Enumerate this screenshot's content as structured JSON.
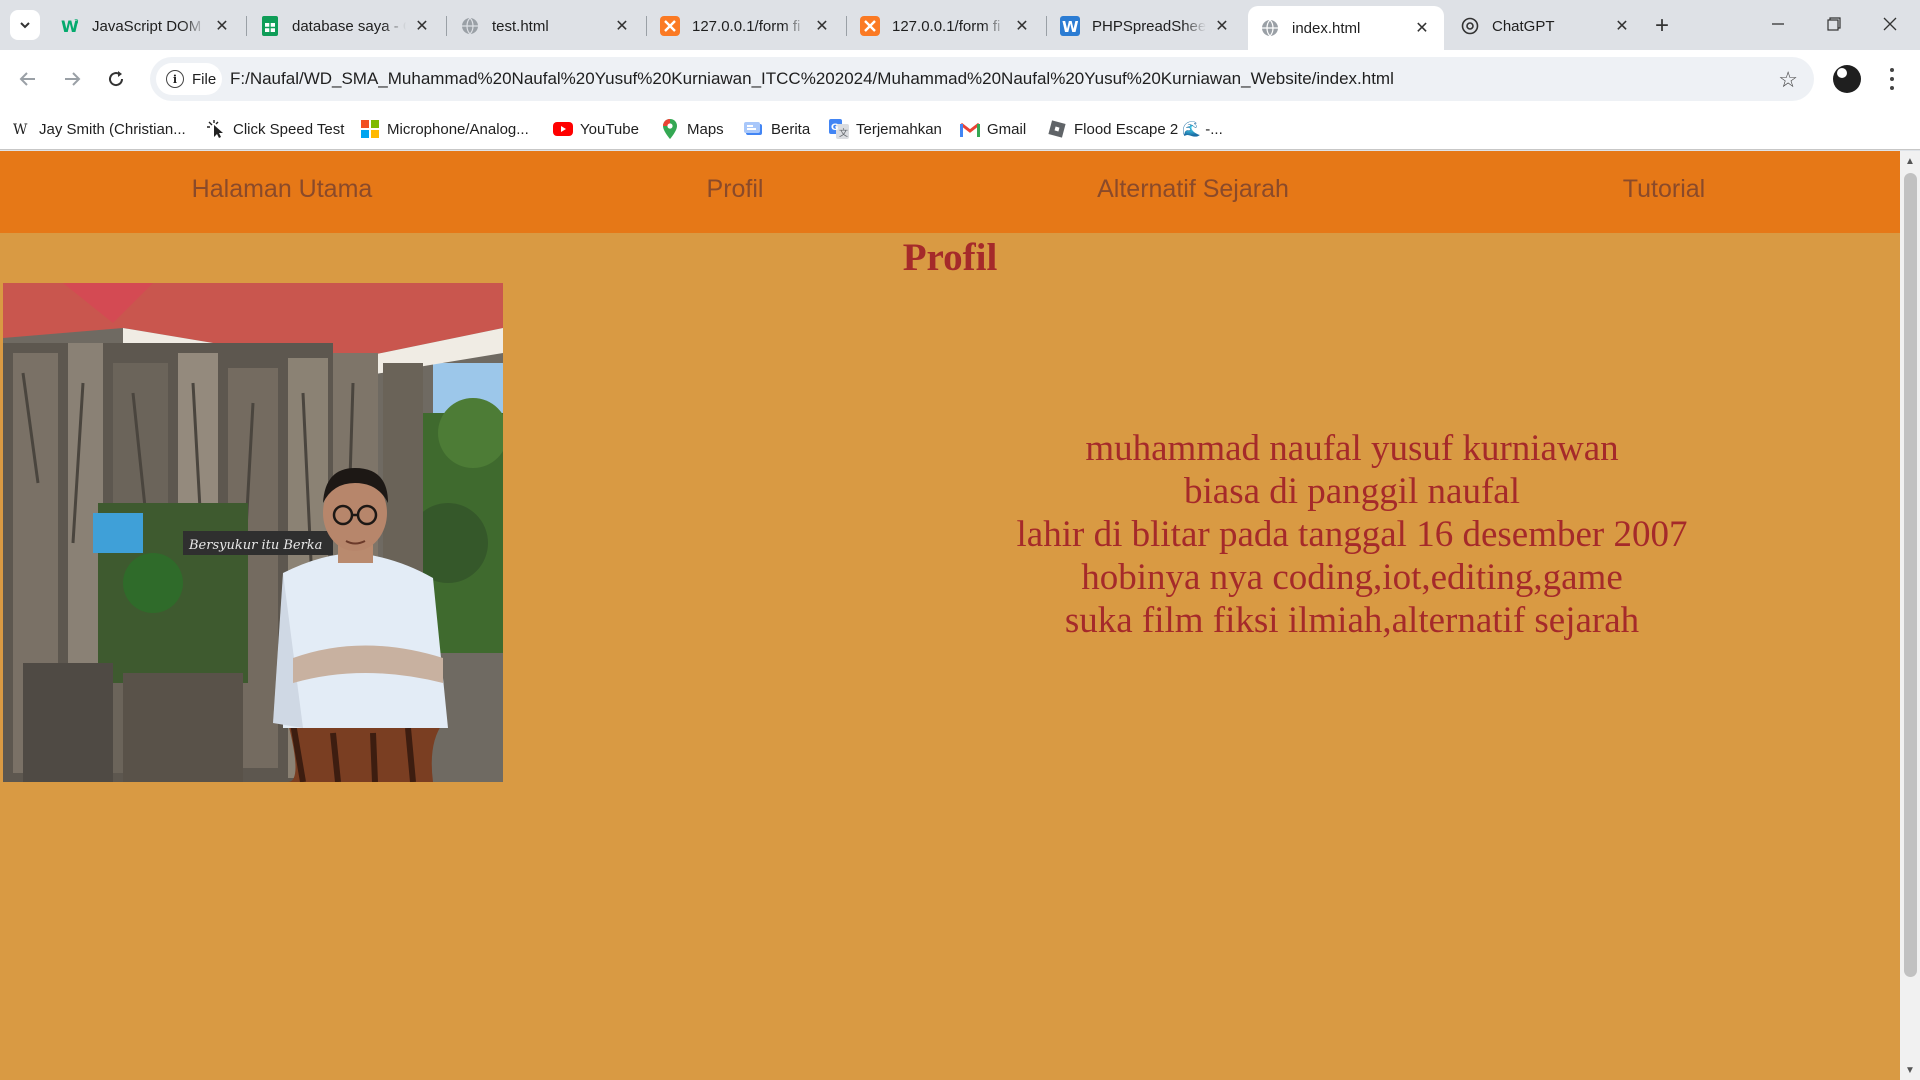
{
  "browser": {
    "tabs": [
      {
        "title": "JavaScript DOM",
        "icon": "w3schools-icon",
        "active": false
      },
      {
        "title": "database saya - G",
        "icon": "google-sheets-icon",
        "active": false
      },
      {
        "title": "test.html",
        "icon": "globe-icon",
        "active": false
      },
      {
        "title": "127.0.0.1/form fi",
        "icon": "xampp-icon",
        "active": false
      },
      {
        "title": "127.0.0.1/form fi",
        "icon": "xampp-icon",
        "active": false
      },
      {
        "title": "PHPSpreadSheet",
        "icon": "word-icon",
        "active": false
      },
      {
        "title": "index.html",
        "icon": "globe-icon",
        "active": true
      },
      {
        "title": "ChatGPT",
        "icon": "chatgpt-icon",
        "active": false
      }
    ],
    "chip_label": "File",
    "url": "F:/Naufal/WD_SMA_Muhammad%20Naufal%20Yusuf%20Kurniawan_ITCC%202024/Muhammad%20Naufal%20Yusuf%20Kurniawan_Website/index.html",
    "bookmarks": [
      {
        "label": "Jay Smith (Christian...",
        "icon": "wiki-icon"
      },
      {
        "label": "Click Speed Test",
        "icon": "cursor-click-icon"
      },
      {
        "label": "Microphone/Analog...",
        "icon": "windows-icon"
      },
      {
        "label": "YouTube",
        "icon": "youtube-icon"
      },
      {
        "label": "Maps",
        "icon": "maps-pin-icon"
      },
      {
        "label": "Berita",
        "icon": "news-icon"
      },
      {
        "label": "Terjemahkan",
        "icon": "translate-icon"
      },
      {
        "label": "Gmail",
        "icon": "gmail-icon"
      },
      {
        "label": "Flood Escape 2 🌊 -...",
        "icon": "roblox-icon"
      }
    ]
  },
  "page": {
    "nav": [
      "Halaman Utama",
      "Profil",
      "Alternatif Sejarah",
      "Tutorial"
    ],
    "title": "Profil",
    "sign_text": "Bersyukur itu Berka",
    "bio": [
      "muhammad naufal yusuf kurniawan",
      "biasa di panggil naufal",
      "lahir di blitar pada tanggal 16 desember 2007",
      "hobinya nya coding,iot,editing,game",
      "suka film fiksi ilmiah,alternatif sejarah"
    ],
    "colors": {
      "navbar": "#e67817",
      "background": "#d99a43",
      "text": "#a52a2a",
      "nav_text": "#8a4a2a"
    }
  }
}
